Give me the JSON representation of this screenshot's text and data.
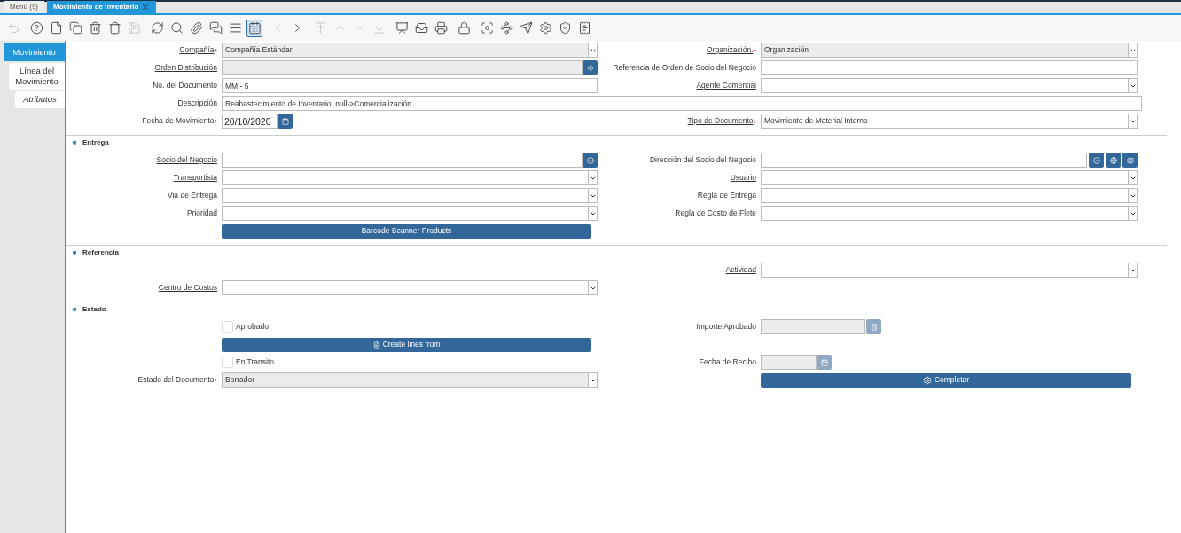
{
  "window_tabs": [
    {
      "label": "Menú (9)",
      "selected": false
    },
    {
      "label": "Movimiento de Inventario",
      "selected": true,
      "closable": true
    }
  ],
  "toolbar": [
    {
      "disabled": true,
      "selected": false
    },
    {
      "disabled": false,
      "selected": false
    },
    {
      "disabled": false,
      "selected": false
    },
    {
      "disabled": false,
      "selected": false
    },
    {
      "disabled": false,
      "selected": false
    },
    {
      "disabled": false,
      "selected": false
    },
    {
      "disabled": true,
      "selected": false
    },
    {
      "disabled": false,
      "selected": false
    },
    {
      "disabled": false,
      "selected": false
    },
    {
      "disabled": false,
      "selected": false
    },
    {
      "disabled": false,
      "selected": false
    },
    {
      "disabled": false,
      "selected": false
    },
    {
      "disabled": false,
      "selected": true
    },
    {
      "disabled": true,
      "selected": false
    },
    {
      "disabled": false,
      "selected": false
    },
    {
      "disabled": true,
      "selected": false
    },
    {
      "disabled": true,
      "selected": false
    },
    {
      "disabled": true,
      "selected": false
    },
    {
      "disabled": true,
      "selected": false
    },
    {
      "disabled": false,
      "selected": false
    },
    {
      "disabled": false,
      "selected": false
    },
    {
      "disabled": false,
      "selected": false
    },
    {
      "disabled": false,
      "selected": false
    },
    {
      "disabled": false,
      "selected": false
    },
    {
      "disabled": false,
      "selected": false
    },
    {
      "disabled": false,
      "selected": false
    },
    {
      "disabled": false,
      "selected": false
    },
    {
      "disabled": false,
      "selected": false
    },
    {
      "disabled": false,
      "selected": false
    }
  ],
  "side_tabs": [
    {
      "label": "Movimiento",
      "selected": true
    },
    {
      "label": "Línea del Movimiento",
      "selected": false,
      "children": [
        {
          "label": "Atributos",
          "selected": false
        }
      ]
    }
  ],
  "header": {
    "rows": [
      {
        "left": {
          "kind": "select",
          "label": "Compañía",
          "link": true,
          "required_mark": "*",
          "value": "Compañía Estándar",
          "readonly": true
        },
        "right": {
          "kind": "select",
          "label": "Organización.",
          "link": true,
          "required_mark": "*",
          "value": "Organización",
          "readonly": true
        }
      },
      {
        "left": {
          "kind": "search",
          "label": "Orden Distribución",
          "link": true,
          "readonly": true,
          "disabled": false
        },
        "right": {
          "kind": "text",
          "label": "Referencia de Orden de Socio del Negocio",
          "link": false,
          "readonly": false
        }
      },
      {
        "left": {
          "kind": "text",
          "label": "No. del Documento",
          "link": false,
          "value": "MMI- 5",
          "readonly": false
        },
        "right": {
          "kind": "select",
          "label": "Agente Comercial",
          "link": true,
          "readonly": false
        }
      },
      {
        "full": {
          "kind": "text",
          "label": "Descripción",
          "link": false,
          "value": "Reabastecimiento de Inventario: null->Comercialización",
          "readonly": false
        }
      },
      {
        "left": {
          "kind": "date",
          "label": "Fecha de Movimiento",
          "link": false,
          "required_mark": "*",
          "value": "20/10/2020",
          "readonly": false,
          "disabled": false
        },
        "right": {
          "kind": "select",
          "label": "Tipo de Documento",
          "link": true,
          "required_mark": "*",
          "value": "Movimiento de Material Interno",
          "readonly": false
        }
      }
    ]
  },
  "sections": [
    {
      "title": "Entrega",
      "expanded": true,
      "rows": [
        {
          "left": {
            "kind": "search",
            "label": "Socio del Negocio",
            "link": true,
            "readonly": false,
            "disabled": false
          },
          "right": {
            "kind": "location",
            "label": "Dirección del Socio del Negocio",
            "link": false,
            "readonly": false
          }
        },
        {
          "left": {
            "kind": "select",
            "label": "Transportista",
            "link": true,
            "readonly": false
          },
          "right": {
            "kind": "select",
            "label": "Usuario",
            "link": true,
            "readonly": false
          }
        },
        {
          "left": {
            "kind": "select",
            "label": "Via de Entrega",
            "link": false,
            "readonly": false
          },
          "right": {
            "kind": "select",
            "label": "Regla de Entrega",
            "link": false,
            "readonly": false
          }
        },
        {
          "left": {
            "kind": "select",
            "label": "Prioridad",
            "link": false,
            "readonly": false
          },
          "right": {
            "kind": "select",
            "label": "Regla de Costo de Flete",
            "link": false,
            "readonly": false
          }
        },
        {
          "left": {
            "kind": "button",
            "label": "Barcode Scanner Products"
          }
        }
      ]
    },
    {
      "title": "Referencia",
      "expanded": true,
      "rows": [
        {
          "right": {
            "kind": "select",
            "label": "Actividad",
            "link": true,
            "readonly": false
          }
        },
        {
          "left": {
            "kind": "select",
            "label": "Centro de Costos",
            "link": true,
            "readonly": false
          }
        }
      ]
    },
    {
      "title": "Estado",
      "expanded": true,
      "rows": [
        {
          "left": {
            "kind": "checkbox",
            "label": "Aprobado",
            "checked": false
          },
          "right": {
            "kind": "number",
            "label": "Importe Aprobado",
            "link": false,
            "readonly": true,
            "disabled": true
          }
        },
        {
          "left": {
            "kind": "document-button",
            "label": "Create lines from"
          }
        },
        {
          "left": {
            "kind": "checkbox",
            "label": "En Transito",
            "checked": false
          },
          "right": {
            "kind": "date",
            "label": "Fecha de Recibo",
            "link": false,
            "readonly": true,
            "disabled": true
          }
        },
        {
          "left": {
            "kind": "select",
            "label": "Estado del Documento",
            "link": false,
            "required_mark": "*",
            "value": "Borrador",
            "readonly": true
          },
          "right": {
            "kind": "process-button",
            "label": "Completar"
          }
        }
      ]
    }
  ]
}
